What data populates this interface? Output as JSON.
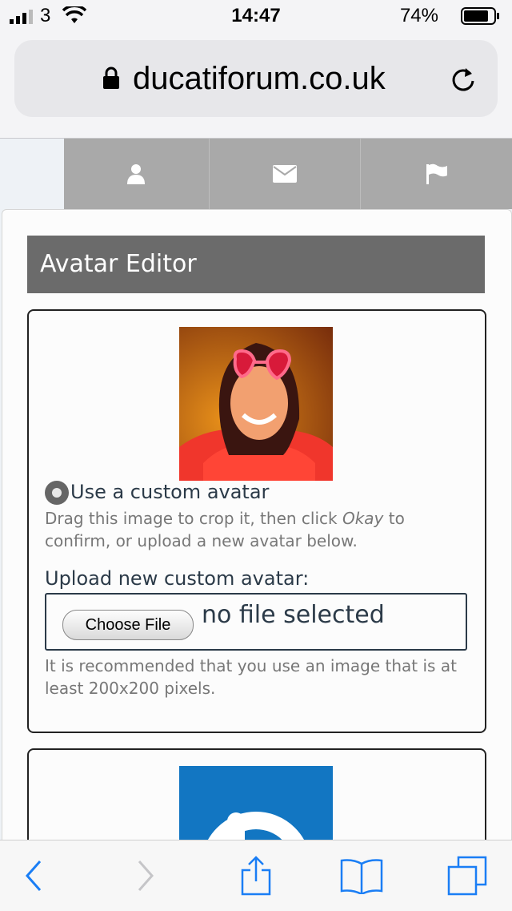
{
  "status_bar": {
    "carrier": "3",
    "time": "14:47",
    "battery": "74%"
  },
  "browser": {
    "url": "ducatiforum.co.uk"
  },
  "page": {
    "title": "Avatar Editor",
    "custom_avatar_label": "Use a custom avatar",
    "crop_help_before": "Drag this image to crop it, then click ",
    "crop_help_okay": "Okay",
    "crop_help_after": " to confirm, or upload a new avatar below.",
    "upload_label": "Upload new custom avatar:",
    "choose_file_label": "Choose File",
    "no_file_text": "no file selected",
    "recommend_text": "It is recommended that you use an image that is at least 200x200 pixels."
  },
  "icons": {
    "nav": [
      "user-icon",
      "envelope-icon",
      "flag-icon"
    ],
    "toolbar": [
      "back-icon",
      "forward-icon",
      "share-icon",
      "bookmarks-icon",
      "tabs-icon"
    ]
  },
  "colors": {
    "title_bar": "#6b6b6b",
    "nav_strip": "#a9a9a9",
    "ios_blue": "#1a7ef5",
    "logo_blue": "#1276c2"
  }
}
